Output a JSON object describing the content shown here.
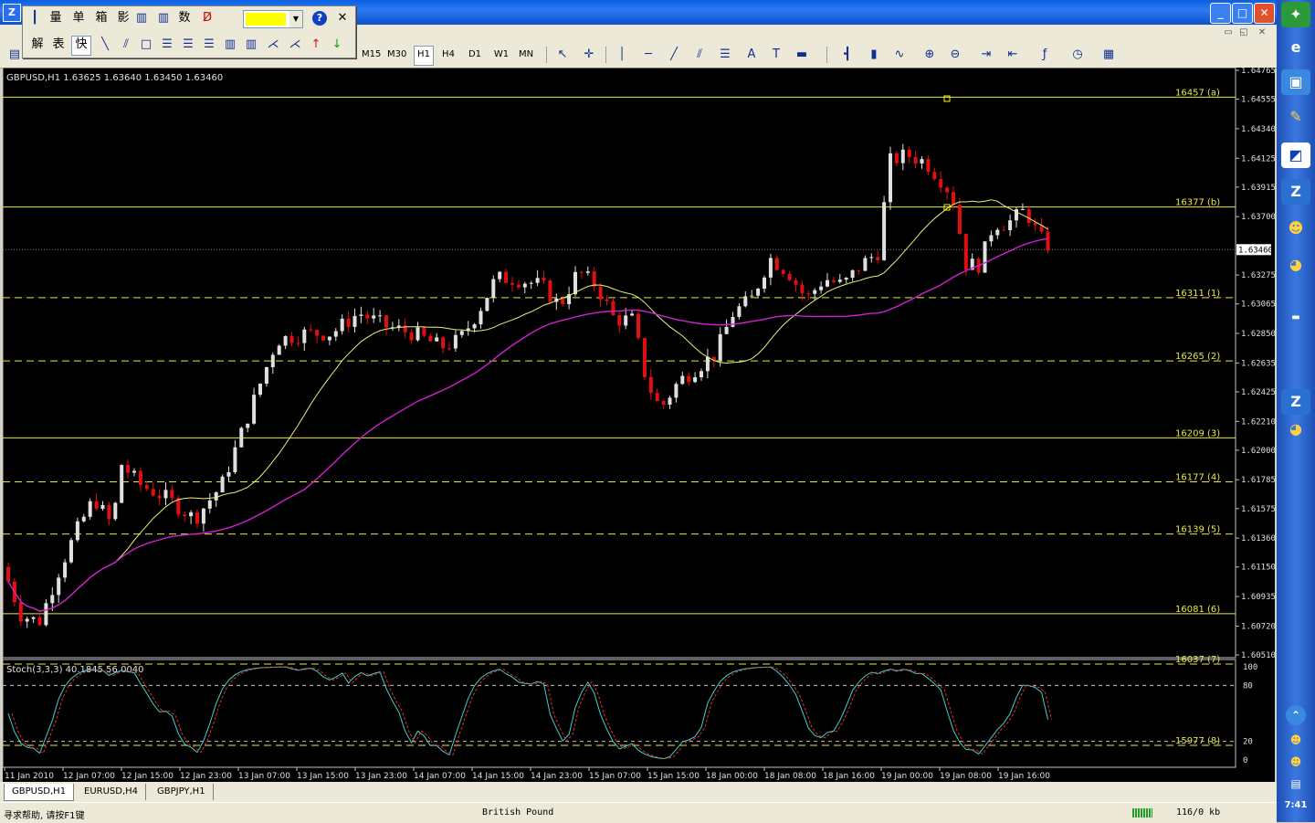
{
  "window": {
    "app_icon": "Z",
    "min": "_",
    "max": "□",
    "close": "✕"
  },
  "menubar": {
    "ctrl_min": "▭",
    "ctrl_max": "◱",
    "ctrl_close": "✕"
  },
  "float_toolbar": {
    "row1": [
      "量",
      "单",
      "箱",
      "影",
      "数"
    ],
    "row2": [
      "解",
      "表",
      "快"
    ],
    "help": "?",
    "close": "✕",
    "color": "#ffff00"
  },
  "timeframes": [
    "M15",
    "M30",
    "H1",
    "H4",
    "D1",
    "W1",
    "MN"
  ],
  "selected_timeframe": "H1",
  "chart": {
    "header": "GBPUSD,H1  1.63625 1.63640 1.63450 1.63460",
    "indicator": "Stoch(3,3,3) 40.1845 56.0040",
    "current_price": "1.63460",
    "price_axis": [
      "1.64765",
      "1.64555",
      "1.64340",
      "1.64125",
      "1.63915",
      "1.63700",
      "1.63275",
      "1.63065",
      "1.62850",
      "1.62635",
      "1.62425",
      "1.62210",
      "1.62000",
      "1.61785",
      "1.61575",
      "1.61360",
      "1.61150",
      "1.60935",
      "1.60720",
      "1.60510"
    ],
    "stoch_axis": [
      "100",
      "80",
      "20",
      "0"
    ],
    "time_axis": [
      "11 Jan 2010",
      "12 Jan 07:00",
      "12 Jan 15:00",
      "12 Jan 23:00",
      "13 Jan 07:00",
      "13 Jan 15:00",
      "13 Jan 23:00",
      "14 Jan 07:00",
      "14 Jan 15:00",
      "14 Jan 23:00",
      "15 Jan 07:00",
      "15 Jan 15:00",
      "18 Jan 00:00",
      "18 Jan 08:00",
      "18 Jan 16:00",
      "19 Jan 00:00",
      "19 Jan 08:00",
      "19 Jan 16:00"
    ],
    "levels": [
      {
        "label": "16457 (a)",
        "price": 1.6457,
        "style": "solid"
      },
      {
        "label": "16377 (b)",
        "price": 1.6377,
        "style": "solid"
      },
      {
        "label": "16311 (1)",
        "price": 1.6311,
        "style": "dash"
      },
      {
        "label": "16265 (2)",
        "price": 1.6265,
        "style": "dash"
      },
      {
        "label": "16209 (3)",
        "price": 1.6209,
        "style": "solid"
      },
      {
        "label": "16177 (4)",
        "price": 1.6177,
        "style": "dash"
      },
      {
        "label": "16139 (5)",
        "price": 1.6139,
        "style": "dash"
      },
      {
        "label": "16081 (6)",
        "price": 1.6081,
        "style": "solid"
      },
      {
        "label": "16037 (7)",
        "price": 1.6037,
        "style": "dash"
      },
      {
        "label": "15977 (8)",
        "price": 1.5977,
        "style": "dash"
      }
    ],
    "colors": {
      "bull": "#e0e0e0",
      "bear": "#e01010",
      "ma_fast": "#e8f080",
      "ma_slow": "#d020d0",
      "level": "#e8e840",
      "stoch_k": "#40d0d0",
      "stoch_d": "#e03030"
    }
  },
  "tabs": [
    "GBPUSD,H1",
    "EURUSD,H4",
    "GBPJPY,H1"
  ],
  "status": {
    "help": "寻求帮助, 请按F1键",
    "profile": "British Pound",
    "traffic": "116/0 kb"
  },
  "tray_clock": "7:41"
}
